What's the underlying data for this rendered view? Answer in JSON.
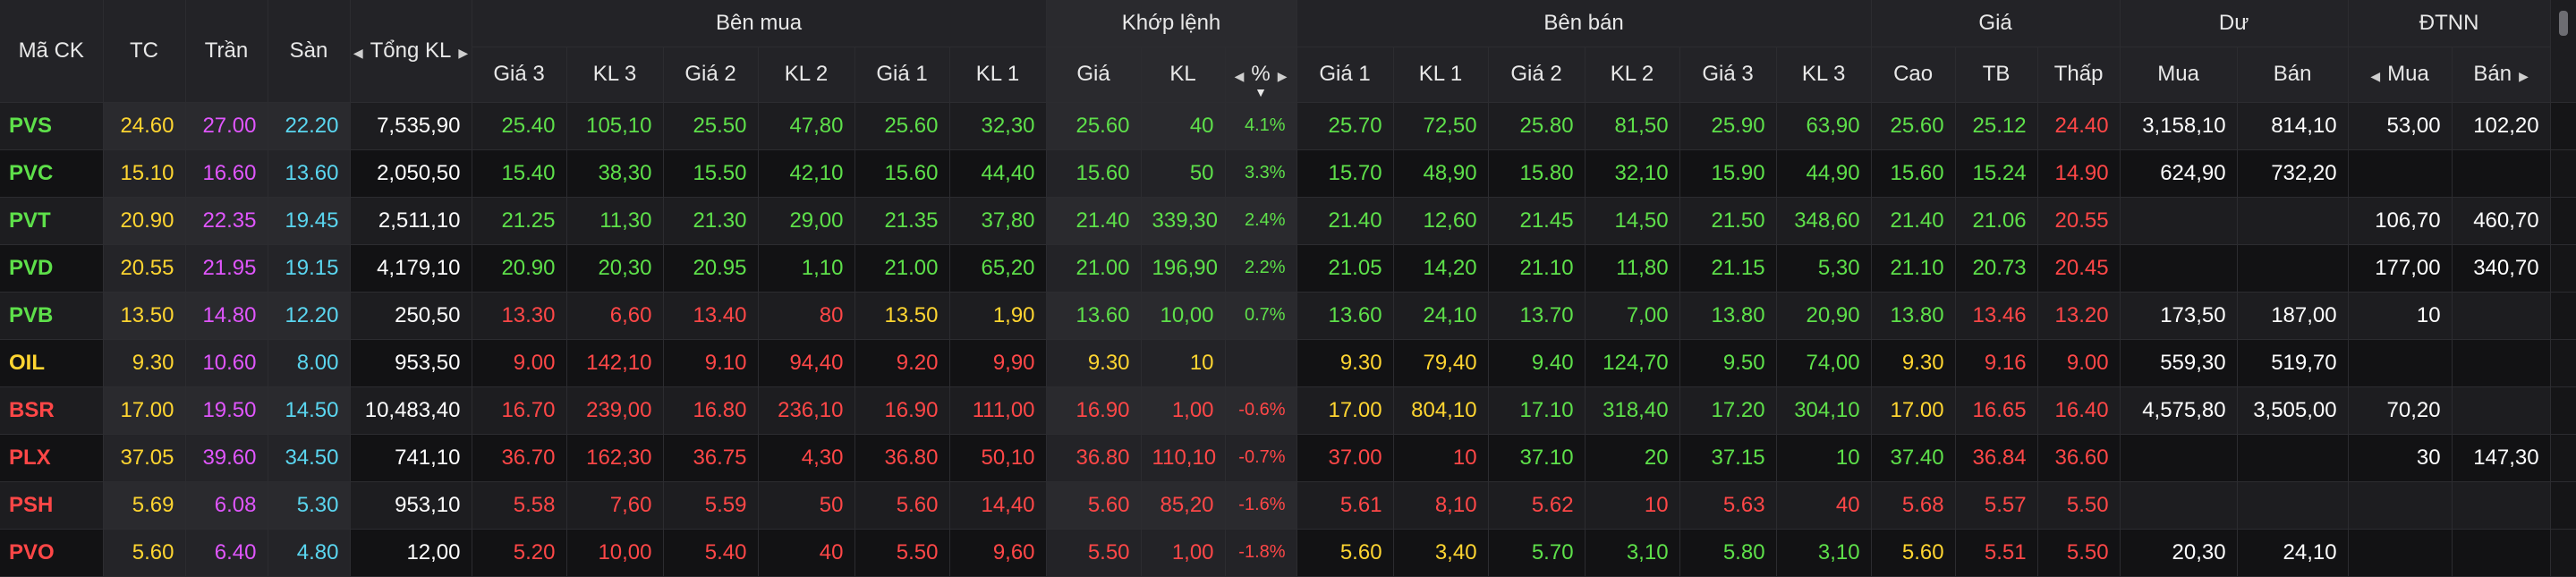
{
  "colors": {
    "up": "#5ee04a",
    "down": "#ff4747",
    "reference": "#ffd531",
    "ceiling": "#e056fd",
    "floor": "#5ad6f0",
    "neutral": "#ffffff",
    "background": "#151517",
    "header_bg": "#232327"
  },
  "header": {
    "groups": {
      "symbol": "Mã CK",
      "ref": "TC",
      "ceil": "Trần",
      "floor": "Sàn",
      "total_vol": "Tổng KL",
      "bid": "Bên mua",
      "match": "Khớp lệnh",
      "ask": "Bên bán",
      "price": "Giá",
      "remain": "Dư",
      "foreign": "ĐTNN"
    },
    "cols": {
      "bid_p3": "Giá 3",
      "bid_v3": "KL 3",
      "bid_p2": "Giá 2",
      "bid_v2": "KL 2",
      "bid_p1": "Giá 1",
      "bid_v1": "KL 1",
      "m_price": "Giá",
      "m_vol": "KL",
      "m_pct": "%",
      "ask_p1": "Giá 1",
      "ask_v1": "KL 1",
      "ask_p2": "Giá 2",
      "ask_v2": "KL 2",
      "ask_p3": "Giá 3",
      "ask_v3": "KL 3",
      "high": "Cao",
      "avg": "TB",
      "low": "Thấp",
      "rem_buy": "Mua",
      "rem_sell": "Bán",
      "f_buy": "Mua",
      "f_sell": "Bán"
    },
    "icons": {
      "left": "◀",
      "right": "▶",
      "down": "▼"
    }
  },
  "rows": [
    {
      "symbol": "PVS",
      "sym_c": "up",
      "tc": "24.60",
      "tran": "27.00",
      "san": "22.20",
      "tkl": "7,535,90",
      "bp3": "25.40",
      "bp3_c": "up",
      "bv3": "105,10",
      "bv3_c": "up",
      "bp2": "25.50",
      "bp2_c": "up",
      "bv2": "47,80",
      "bv2_c": "up",
      "bp1": "25.60",
      "bp1_c": "up",
      "bv1": "32,30",
      "bv1_c": "up",
      "mp": "25.60",
      "mp_c": "up",
      "mv": "40",
      "mv_c": "up",
      "mpct": "4.1%",
      "mpct_c": "up",
      "ap1": "25.70",
      "ap1_c": "up",
      "av1": "72,50",
      "av1_c": "up",
      "ap2": "25.80",
      "ap2_c": "up",
      "av2": "81,50",
      "av2_c": "up",
      "ap3": "25.90",
      "ap3_c": "up",
      "av3": "63,90",
      "av3_c": "up",
      "hi": "25.60",
      "hi_c": "up",
      "avg": "25.12",
      "avg_c": "up",
      "lo": "24.40",
      "lo_c": "down",
      "rb": "3,158,10",
      "rs": "814,10",
      "fb": "53,00",
      "fs": "102,20"
    },
    {
      "symbol": "PVC",
      "sym_c": "up",
      "tc": "15.10",
      "tran": "16.60",
      "san": "13.60",
      "tkl": "2,050,50",
      "bp3": "15.40",
      "bp3_c": "up",
      "bv3": "38,30",
      "bv3_c": "up",
      "bp2": "15.50",
      "bp2_c": "up",
      "bv2": "42,10",
      "bv2_c": "up",
      "bp1": "15.60",
      "bp1_c": "up",
      "bv1": "44,40",
      "bv1_c": "up",
      "mp": "15.60",
      "mp_c": "up",
      "mv": "50",
      "mv_c": "up",
      "mpct": "3.3%",
      "mpct_c": "up",
      "ap1": "15.70",
      "ap1_c": "up",
      "av1": "48,90",
      "av1_c": "up",
      "ap2": "15.80",
      "ap2_c": "up",
      "av2": "32,10",
      "av2_c": "up",
      "ap3": "15.90",
      "ap3_c": "up",
      "av3": "44,90",
      "av3_c": "up",
      "hi": "15.60",
      "hi_c": "up",
      "avg": "15.24",
      "avg_c": "up",
      "lo": "14.90",
      "lo_c": "down",
      "rb": "624,90",
      "rs": "732,20",
      "fb": "",
      "fs": ""
    },
    {
      "symbol": "PVT",
      "sym_c": "up",
      "tc": "20.90",
      "tran": "22.35",
      "san": "19.45",
      "tkl": "2,511,10",
      "bp3": "21.25",
      "bp3_c": "up",
      "bv3": "11,30",
      "bv3_c": "up",
      "bp2": "21.30",
      "bp2_c": "up",
      "bv2": "29,00",
      "bv2_c": "up",
      "bp1": "21.35",
      "bp1_c": "up",
      "bv1": "37,80",
      "bv1_c": "up",
      "mp": "21.40",
      "mp_c": "up",
      "mv": "339,30",
      "mv_c": "up",
      "mpct": "2.4%",
      "mpct_c": "up",
      "ap1": "21.40",
      "ap1_c": "up",
      "av1": "12,60",
      "av1_c": "up",
      "ap2": "21.45",
      "ap2_c": "up",
      "av2": "14,50",
      "av2_c": "up",
      "ap3": "21.50",
      "ap3_c": "up",
      "av3": "348,60",
      "av3_c": "up",
      "hi": "21.40",
      "hi_c": "up",
      "avg": "21.06",
      "avg_c": "up",
      "lo": "20.55",
      "lo_c": "down",
      "rb": "",
      "rs": "",
      "fb": "106,70",
      "fs": "460,70"
    },
    {
      "symbol": "PVD",
      "sym_c": "up",
      "tc": "20.55",
      "tran": "21.95",
      "san": "19.15",
      "tkl": "4,179,10",
      "bp3": "20.90",
      "bp3_c": "up",
      "bv3": "20,30",
      "bv3_c": "up",
      "bp2": "20.95",
      "bp2_c": "up",
      "bv2": "1,10",
      "bv2_c": "up",
      "bp1": "21.00",
      "bp1_c": "up",
      "bv1": "65,20",
      "bv1_c": "up",
      "mp": "21.00",
      "mp_c": "up",
      "mv": "196,90",
      "mv_c": "up",
      "mpct": "2.2%",
      "mpct_c": "up",
      "ap1": "21.05",
      "ap1_c": "up",
      "av1": "14,20",
      "av1_c": "up",
      "ap2": "21.10",
      "ap2_c": "up",
      "av2": "11,80",
      "av2_c": "up",
      "ap3": "21.15",
      "ap3_c": "up",
      "av3": "5,30",
      "av3_c": "up",
      "hi": "21.10",
      "hi_c": "up",
      "avg": "20.73",
      "avg_c": "up",
      "lo": "20.45",
      "lo_c": "down",
      "rb": "",
      "rs": "",
      "fb": "177,00",
      "fs": "340,70"
    },
    {
      "symbol": "PVB",
      "sym_c": "up",
      "tc": "13.50",
      "tran": "14.80",
      "san": "12.20",
      "tkl": "250,50",
      "bp3": "13.30",
      "bp3_c": "down",
      "bv3": "6,60",
      "bv3_c": "down",
      "bp2": "13.40",
      "bp2_c": "down",
      "bv2": "80",
      "bv2_c": "down",
      "bp1": "13.50",
      "bp1_c": "ref",
      "bv1": "1,90",
      "bv1_c": "ref",
      "mp": "13.60",
      "mp_c": "up",
      "mv": "10,00",
      "mv_c": "up",
      "mpct": "0.7%",
      "mpct_c": "up",
      "ap1": "13.60",
      "ap1_c": "up",
      "av1": "24,10",
      "av1_c": "up",
      "ap2": "13.70",
      "ap2_c": "up",
      "av2": "7,00",
      "av2_c": "up",
      "ap3": "13.80",
      "ap3_c": "up",
      "av3": "20,90",
      "av3_c": "up",
      "hi": "13.80",
      "hi_c": "up",
      "avg": "13.46",
      "avg_c": "down",
      "lo": "13.20",
      "lo_c": "down",
      "rb": "173,50",
      "rs": "187,00",
      "fb": "10",
      "fs": ""
    },
    {
      "symbol": "OIL",
      "sym_c": "ref",
      "tc": "9.30",
      "tran": "10.60",
      "san": "8.00",
      "tkl": "953,50",
      "bp3": "9.00",
      "bp3_c": "down",
      "bv3": "142,10",
      "bv3_c": "down",
      "bp2": "9.10",
      "bp2_c": "down",
      "bv2": "94,40",
      "bv2_c": "down",
      "bp1": "9.20",
      "bp1_c": "down",
      "bv1": "9,90",
      "bv1_c": "down",
      "mp": "9.30",
      "mp_c": "ref",
      "mv": "10",
      "mv_c": "ref",
      "mpct": "",
      "mpct_c": "ref",
      "ap1": "9.30",
      "ap1_c": "ref",
      "av1": "79,40",
      "av1_c": "ref",
      "ap2": "9.40",
      "ap2_c": "up",
      "av2": "124,70",
      "av2_c": "up",
      "ap3": "9.50",
      "ap3_c": "up",
      "av3": "74,00",
      "av3_c": "up",
      "hi": "9.30",
      "hi_c": "ref",
      "avg": "9.16",
      "avg_c": "down",
      "lo": "9.00",
      "lo_c": "down",
      "rb": "559,30",
      "rs": "519,70",
      "fb": "",
      "fs": ""
    },
    {
      "symbol": "BSR",
      "sym_c": "down",
      "tc": "17.00",
      "tran": "19.50",
      "san": "14.50",
      "tkl": "10,483,40",
      "bp3": "16.70",
      "bp3_c": "down",
      "bv3": "239,00",
      "bv3_c": "down",
      "bp2": "16.80",
      "bp2_c": "down",
      "bv2": "236,10",
      "bv2_c": "down",
      "bp1": "16.90",
      "bp1_c": "down",
      "bv1": "111,00",
      "bv1_c": "down",
      "mp": "16.90",
      "mp_c": "down",
      "mv": "1,00",
      "mv_c": "down",
      "mpct": "-0.6%",
      "mpct_c": "down",
      "ap1": "17.00",
      "ap1_c": "ref",
      "av1": "804,10",
      "av1_c": "ref",
      "ap2": "17.10",
      "ap2_c": "up",
      "av2": "318,40",
      "av2_c": "up",
      "ap3": "17.20",
      "ap3_c": "up",
      "av3": "304,10",
      "av3_c": "up",
      "hi": "17.00",
      "hi_c": "ref",
      "avg": "16.65",
      "avg_c": "down",
      "lo": "16.40",
      "lo_c": "down",
      "rb": "4,575,80",
      "rs": "3,505,00",
      "fb": "70,20",
      "fs": ""
    },
    {
      "symbol": "PLX",
      "sym_c": "down",
      "tc": "37.05",
      "tran": "39.60",
      "san": "34.50",
      "tkl": "741,10",
      "bp3": "36.70",
      "bp3_c": "down",
      "bv3": "162,30",
      "bv3_c": "down",
      "bp2": "36.75",
      "bp2_c": "down",
      "bv2": "4,30",
      "bv2_c": "down",
      "bp1": "36.80",
      "bp1_c": "down",
      "bv1": "50,10",
      "bv1_c": "down",
      "mp": "36.80",
      "mp_c": "down",
      "mv": "110,10",
      "mv_c": "down",
      "mpct": "-0.7%",
      "mpct_c": "down",
      "ap1": "37.00",
      "ap1_c": "down",
      "av1": "10",
      "av1_c": "down",
      "ap2": "37.10",
      "ap2_c": "up",
      "av2": "20",
      "av2_c": "up",
      "ap3": "37.15",
      "ap3_c": "up",
      "av3": "10",
      "av3_c": "up",
      "hi": "37.40",
      "hi_c": "up",
      "avg": "36.84",
      "avg_c": "down",
      "lo": "36.60",
      "lo_c": "down",
      "rb": "",
      "rs": "",
      "fb": "30",
      "fs": "147,30"
    },
    {
      "symbol": "PSH",
      "sym_c": "down",
      "tc": "5.69",
      "tran": "6.08",
      "san": "5.30",
      "tkl": "953,10",
      "bp3": "5.58",
      "bp3_c": "down",
      "bv3": "7,60",
      "bv3_c": "down",
      "bp2": "5.59",
      "bp2_c": "down",
      "bv2": "50",
      "bv2_c": "down",
      "bp1": "5.60",
      "bp1_c": "down",
      "bv1": "14,40",
      "bv1_c": "down",
      "mp": "5.60",
      "mp_c": "down",
      "mv": "85,20",
      "mv_c": "down",
      "mpct": "-1.6%",
      "mpct_c": "down",
      "ap1": "5.61",
      "ap1_c": "down",
      "av1": "8,10",
      "av1_c": "down",
      "ap2": "5.62",
      "ap2_c": "down",
      "av2": "10",
      "av2_c": "down",
      "ap3": "5.63",
      "ap3_c": "down",
      "av3": "40",
      "av3_c": "down",
      "hi": "5.68",
      "hi_c": "down",
      "avg": "5.57",
      "avg_c": "down",
      "lo": "5.50",
      "lo_c": "down",
      "rb": "",
      "rs": "",
      "fb": "",
      "fs": ""
    },
    {
      "symbol": "PVO",
      "sym_c": "down",
      "tc": "5.60",
      "tran": "6.40",
      "san": "4.80",
      "tkl": "12,00",
      "bp3": "5.20",
      "bp3_c": "down",
      "bv3": "10,00",
      "bv3_c": "down",
      "bp2": "5.40",
      "bp2_c": "down",
      "bv2": "40",
      "bv2_c": "down",
      "bp1": "5.50",
      "bp1_c": "down",
      "bv1": "9,60",
      "bv1_c": "down",
      "mp": "5.50",
      "mp_c": "down",
      "mv": "1,00",
      "mv_c": "down",
      "mpct": "-1.8%",
      "mpct_c": "down",
      "ap1": "5.60",
      "ap1_c": "ref",
      "av1": "3,40",
      "av1_c": "ref",
      "ap2": "5.70",
      "ap2_c": "up",
      "av2": "3,10",
      "av2_c": "up",
      "ap3": "5.80",
      "ap3_c": "up",
      "av3": "3,10",
      "av3_c": "up",
      "hi": "5.60",
      "hi_c": "ref",
      "avg": "5.51",
      "avg_c": "down",
      "lo": "5.50",
      "lo_c": "down",
      "rb": "20,30",
      "rs": "24,10",
      "fb": "",
      "fs": ""
    }
  ]
}
